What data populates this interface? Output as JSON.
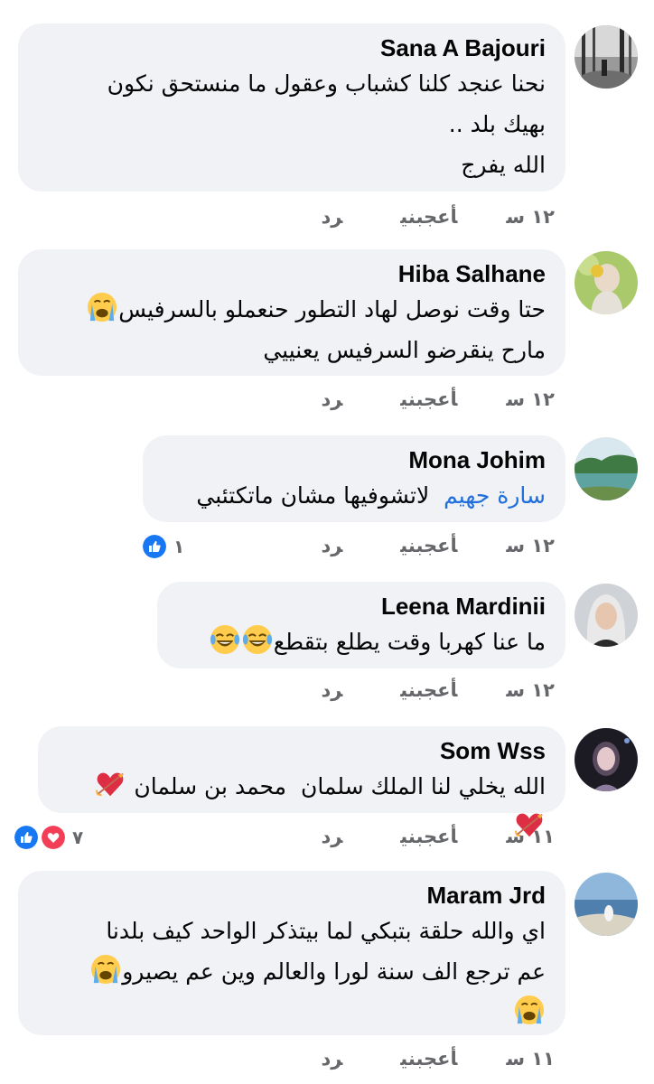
{
  "colors": {
    "bubble": "#f0f2f5",
    "mention": "#216fdb",
    "meta": "#65676b",
    "like_blue": "#1877f2",
    "love_red": "#f33e58"
  },
  "comments": [
    {
      "author": "Sana A Bajouri",
      "lines": [
        "نحنا عنجد كلنا كشباب وعقول ما منستحق نكون",
        "بهيك بلد ..",
        "الله يفرج"
      ],
      "time": "١٢ س",
      "like": "أعجبني",
      "reply": "رد",
      "avatar": "forest-photo-avatar"
    },
    {
      "author": "Hiba Salhane",
      "lines": [
        "حتا وقت نوصل لهاد التطور حنعملو بالسرفيس",
        "مارح ينقرضو السرفيس يعنييي"
      ],
      "emojis": [
        "loudly-crying-emoji"
      ],
      "time": "١٢ س",
      "like": "أعجبني",
      "reply": "رد",
      "avatar": "woman-photo-avatar"
    },
    {
      "author": "Mona Johim",
      "mention": "سارة جهيم",
      "lines": [
        "لاتشوفيها مشان ماتكتئبي"
      ],
      "time": "١٢ س",
      "like": "أعجبني",
      "reply": "رد",
      "reaction_count": "١",
      "reactions": [
        "like-icon"
      ],
      "avatar": "lake-photo-avatar"
    },
    {
      "author": "Leena Mardinii",
      "lines": [
        "ما عنا كهربا وقت يطلع بتقطع"
      ],
      "emojis": [
        "tears-of-joy-emoji",
        "tears-of-joy-emoji"
      ],
      "time": "١٢ س",
      "like": "أعجبني",
      "reply": "رد",
      "avatar": "woman-hijab-avatar"
    },
    {
      "author": "Som Wss",
      "lines": [
        "الله يخلي لنا الملك سلمان  محمد بن سلمان"
      ],
      "emojis": [
        "heart-arrow-emoji",
        "heart-arrow-emoji"
      ],
      "time": "١١ س",
      "like": "أعجبني",
      "reply": "رد",
      "reaction_count": "٧",
      "reactions": [
        "like-icon",
        "love-icon"
      ],
      "avatar": "portrait-photo-avatar"
    },
    {
      "author": "Maram Jrd",
      "lines": [
        "اي والله حلقة بتبكي لما بيتذكر الواحد كيف بلدنا",
        "عم ترجع الف سنة لورا والعالم وين عم يصيرو"
      ],
      "emojis": [
        "loudly-crying-emoji",
        "loudly-crying-emoji"
      ],
      "time": "١١ س",
      "like": "أعجبني",
      "reply": "رد",
      "avatar": "sea-photo-avatar"
    }
  ]
}
